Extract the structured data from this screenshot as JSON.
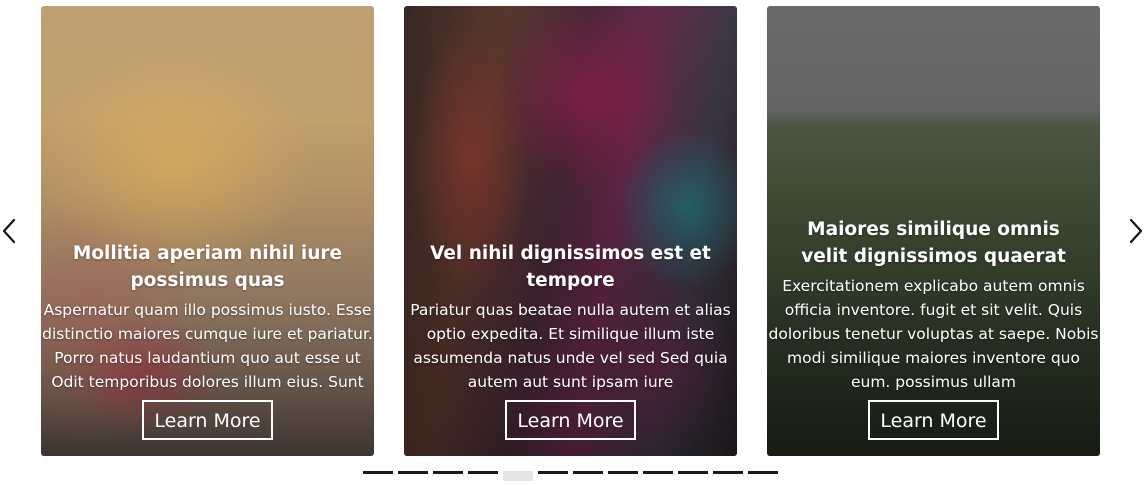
{
  "carousel": {
    "prev_icon": "chevron-left-icon",
    "next_icon": "chevron-right-icon",
    "cards": [
      {
        "title": "Mollitia aperiam nihil iure possimus quas",
        "description": "Aspernatur quam illo possimus iusto. Esse distinctio maiores cumque iure et pariatur. Porro natus laudantium quo aut esse ut Odit temporibus dolores illum eius. Sunt",
        "button_label": "Learn More"
      },
      {
        "title": "Vel nihil dignissimos est et tempore",
        "description": "Pariatur quas beatae nulla autem et alias optio expedita. Et similique illum iste assumenda natus unde vel sed Sed quia autem aut sunt ipsam iure",
        "button_label": "Learn More"
      },
      {
        "title": "Maiores similique omnis velit dignissimos quaerat",
        "description": "Exercitationem explicabo autem omnis officia inventore. fugit et sit velit. Quis doloribus tenetur voluptas at saepe. Nobis modi similique maiores inventore quo eum. possimus ullam",
        "button_label": "Learn More"
      }
    ],
    "pagination": {
      "total": 12,
      "active_index": 4
    }
  },
  "colors": {
    "text": "#ffffff",
    "indicator": "#1a1a1a",
    "indicator_active": "#e5e5e5"
  }
}
